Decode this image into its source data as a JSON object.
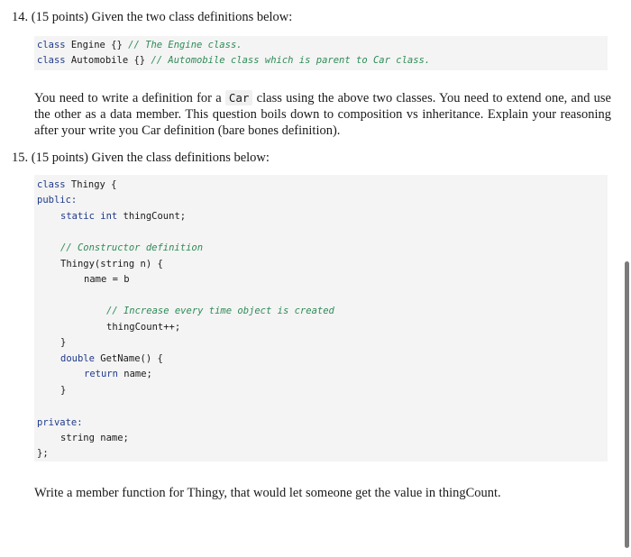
{
  "q14": {
    "number": "14.",
    "points": "(15 points)",
    "prompt": "Given the two class definitions below:",
    "code": {
      "line1_kw": "class",
      "line1_name": " Engine {} ",
      "line1_comment": "// The Engine class.",
      "line2_kw": "class",
      "line2_name": " Automobile {} ",
      "line2_comment": "// Automobile class which is parent to Car class."
    },
    "body_part1": "You need to write a definition for a",
    "body_code": "Car",
    "body_part2": "class using the above two classes. You need to extend one, and use the other as a data member. This question boils down to composition vs inheritance. Explain your reasoning after your write you Car definition (bare bones definition)."
  },
  "q15": {
    "number": "15.",
    "points": "(15 points)",
    "prompt": "Given the class definitions below:",
    "code": {
      "l1_kw": "class",
      "l1_rest": " Thingy {",
      "l2_kw": "public:",
      "l3_kw1": "static",
      "l3_kw2": "int",
      "l3_rest": " thingCount;",
      "l4_comment": "// Constructor definition",
      "l5": "Thingy(string n) {",
      "l6": "name = b",
      "l7_comment": "// Increase every time object is created",
      "l8": "thingCount++;",
      "l9": "}",
      "l10_kw": "double",
      "l10_rest": " GetName() {",
      "l11_kw": "return",
      "l11_rest": " name;",
      "l12": "}",
      "l13_kw": "private:",
      "l14_kw": "string",
      "l14_rest": " name;",
      "l15": "};"
    },
    "task": "Write a member function for Thingy, that would let someone get the value in thingCount."
  },
  "colors": {
    "keyword": "#1f3a8a",
    "comment": "#2e8b57",
    "code_background": "#f4f4f4",
    "scrollbar_thumb": "#7b7b7b"
  }
}
